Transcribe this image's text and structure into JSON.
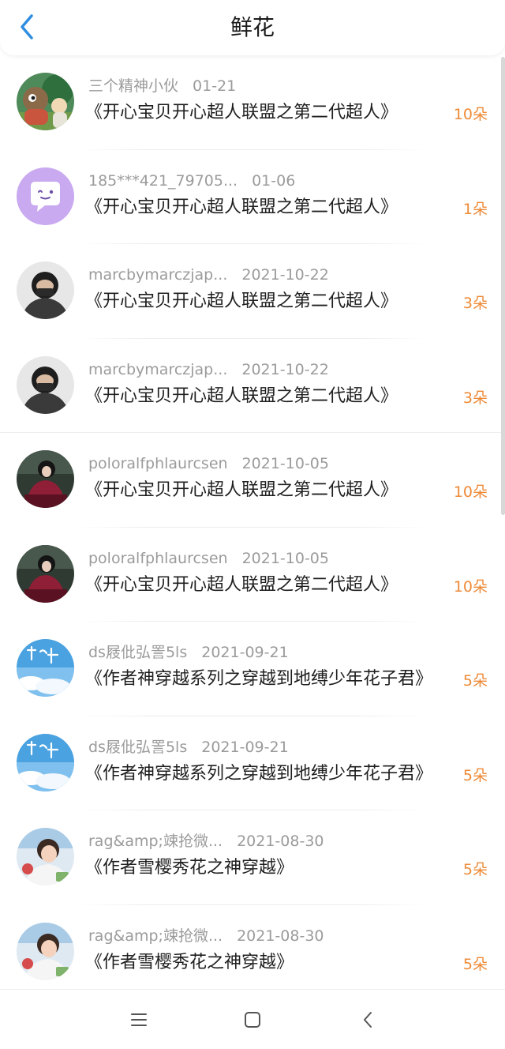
{
  "header": {
    "title": "鲜花",
    "back_icon": "chevron-left-icon",
    "accent_color": "#2f8ee0"
  },
  "items": [
    {
      "name": "三个精神小伙",
      "date": "01-21",
      "book": "《开心宝贝开心超人联盟之第二代超人》",
      "count": "10朵",
      "avatar": "cartoon-avatar"
    },
    {
      "name": "185***421_79705...",
      "date": "01-06",
      "book": "《开心宝贝开心超人联盟之第二代超人》",
      "count": "1朵",
      "avatar": "chat-bubble-avatar"
    },
    {
      "name": "marcbymarczjap...",
      "date": "2021-10-22",
      "book": "《开心宝贝开心超人联盟之第二代超人》",
      "count": "3朵",
      "avatar": "masked-person-avatar"
    },
    {
      "name": "marcbymarczjap...",
      "date": "2021-10-22",
      "book": "《开心宝贝开心超人联盟之第二代超人》",
      "count": "3朵",
      "avatar": "masked-person-avatar"
    },
    {
      "name": "poloralfphlaurcsen",
      "date": "2021-10-05",
      "book": "《开心宝贝开心超人联盟之第二代超人》",
      "count": "10朵",
      "avatar": "woman-portrait-avatar"
    },
    {
      "name": "poloralfphlaurcsen",
      "date": "2021-10-05",
      "book": "《开心宝贝开心超人联盟之第二代超人》",
      "count": "10朵",
      "avatar": "woman-portrait-avatar"
    },
    {
      "name": "ds屐仳弘詈5ls",
      "date": "2021-09-21",
      "book": "《作者神穿越系列之穿越到地缚少年花子君》",
      "count": "5朵",
      "avatar": "sky-calligraphy-avatar"
    },
    {
      "name": "ds屐仳弘詈5ls",
      "date": "2021-09-21",
      "book": "《作者神穿越系列之穿越到地缚少年花子君》",
      "count": "5朵",
      "avatar": "sky-calligraphy-avatar"
    },
    {
      "name": "rag&amp;竦抢微...",
      "date": "2021-08-30",
      "book": "《作者雪樱秀花之神穿越》",
      "count": "5朵",
      "avatar": "child-photo-avatar"
    },
    {
      "name": "rag&amp;竦抢微...",
      "date": "2021-08-30",
      "book": "《作者雪樱秀花之神穿越》",
      "count": "5朵",
      "avatar": "child-photo-avatar"
    }
  ],
  "colors": {
    "count": "#ee8a37",
    "meta": "#9b9b9b",
    "text": "#1f1f1f"
  },
  "navbar": {
    "menu_icon": "menu-icon",
    "home_icon": "home-square-icon",
    "back_icon": "back-triangle-icon"
  }
}
